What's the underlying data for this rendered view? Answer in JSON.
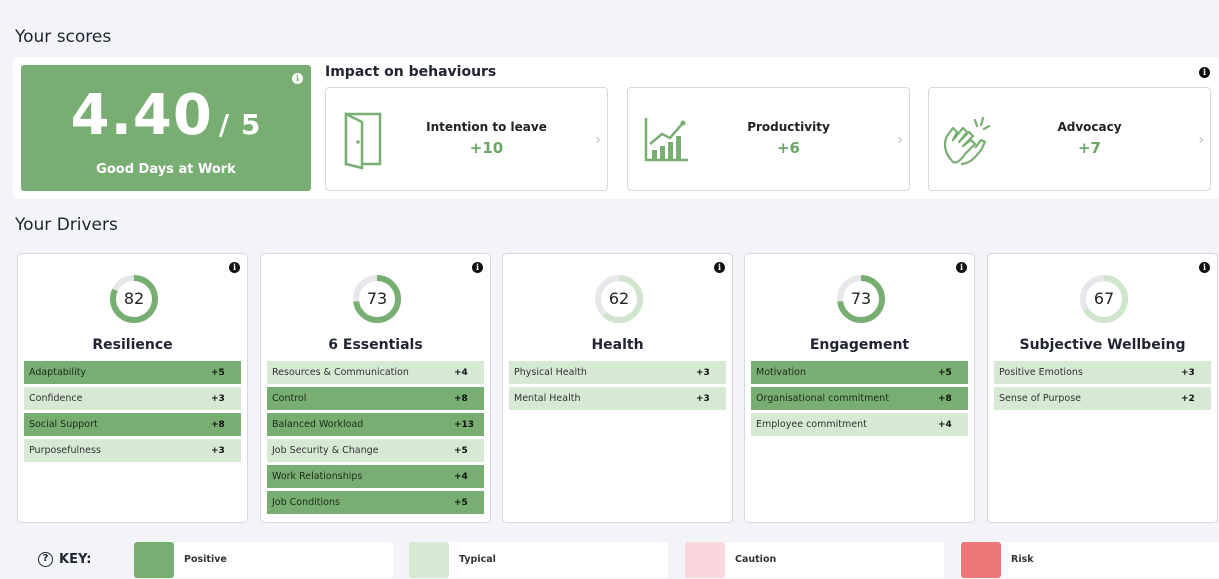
{
  "scores_title": "Your scores",
  "good_days": {
    "score": "4.40",
    "denominator": "/ 5",
    "label": "Good Days at Work"
  },
  "impact": {
    "title": "Impact on behaviours",
    "cards": [
      {
        "name": "Intention to leave",
        "value": "+10",
        "icon": "door-icon"
      },
      {
        "name": "Productivity",
        "value": "+6",
        "icon": "growth-chart-icon"
      },
      {
        "name": "Advocacy",
        "value": "+7",
        "icon": "clapping-hands-icon"
      }
    ]
  },
  "drivers_title": "Your Drivers",
  "drivers": [
    {
      "name": "Resilience",
      "score": "82",
      "fill": 0.82,
      "rows": [
        {
          "label": "Adaptability",
          "value": "+5",
          "level": "positive"
        },
        {
          "label": "Confidence",
          "value": "+3",
          "level": "typical"
        },
        {
          "label": "Social Support",
          "value": "+8",
          "level": "positive"
        },
        {
          "label": "Purposefulness",
          "value": "+3",
          "level": "typical"
        }
      ]
    },
    {
      "name": "6 Essentials",
      "score": "73",
      "fill": 0.73,
      "rows": [
        {
          "label": "Resources & Communication",
          "value": "+4",
          "level": "typical"
        },
        {
          "label": "Control",
          "value": "+8",
          "level": "positive"
        },
        {
          "label": "Balanced Workload",
          "value": "+13",
          "level": "positive"
        },
        {
          "label": "Job Security & Change",
          "value": "+5",
          "level": "typical"
        },
        {
          "label": "Work Relationships",
          "value": "+4",
          "level": "positive"
        },
        {
          "label": "Job Conditions",
          "value": "+5",
          "level": "positive"
        }
      ]
    },
    {
      "name": "Health",
      "score": "62",
      "fill": 0.62,
      "rows": [
        {
          "label": "Physical Health",
          "value": "+3",
          "level": "typical"
        },
        {
          "label": "Mental Health",
          "value": "+3",
          "level": "typical"
        }
      ]
    },
    {
      "name": "Engagement",
      "score": "73",
      "fill": 0.73,
      "rows": [
        {
          "label": "Motivation",
          "value": "+5",
          "level": "positive"
        },
        {
          "label": "Organisational commitment",
          "value": "+8",
          "level": "positive"
        },
        {
          "label": "Employee commitment",
          "value": "+4",
          "level": "typical"
        }
      ]
    },
    {
      "name": "Subjective Wellbeing",
      "score": "67",
      "fill": 0.67,
      "rows": [
        {
          "label": "Positive Emotions",
          "value": "+3",
          "level": "typical"
        },
        {
          "label": "Sense of Purpose",
          "value": "+2",
          "level": "typical"
        }
      ]
    }
  ],
  "key": {
    "title": "KEY:",
    "items": [
      {
        "label": "Positive",
        "color": "#79ae73"
      },
      {
        "label": "Typical",
        "color": "#d5e9d3"
      },
      {
        "label": "Caution",
        "color": "#f9d7dc"
      },
      {
        "label": "Risk",
        "color": "#ec7777"
      }
    ]
  },
  "colors": {
    "positive": "#79ae73",
    "typical": "#d5e9d3",
    "accent_text": "#6aa665"
  }
}
